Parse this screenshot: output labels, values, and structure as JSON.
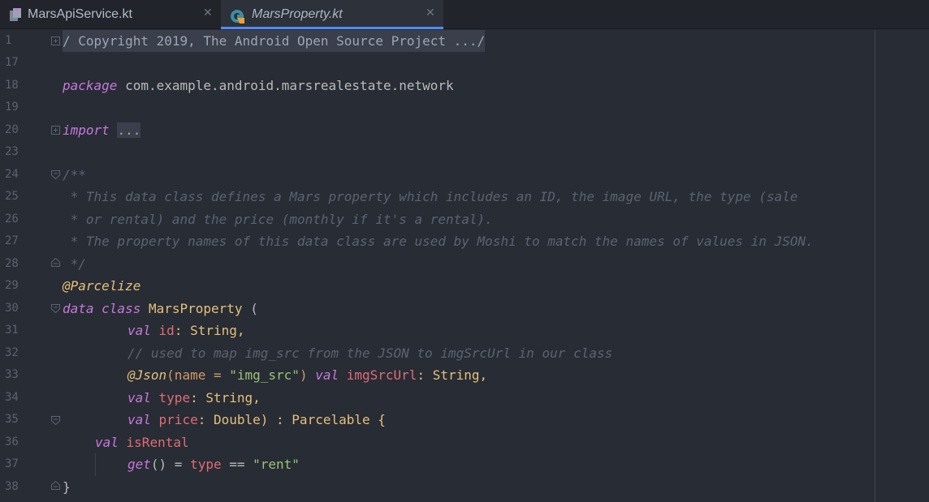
{
  "tabs": [
    {
      "label": "MarsApiService.kt",
      "close": "✕",
      "active": false
    },
    {
      "label": "MarsProperty.kt",
      "close": "✕",
      "active": true
    }
  ],
  "line_numbers": [
    "1",
    "17",
    "18",
    "19",
    "20",
    "23",
    "24",
    "25",
    "26",
    "27",
    "28",
    "29",
    "30",
    "31",
    "32",
    "33",
    "34",
    "35",
    "36",
    "37",
    "38"
  ],
  "code": {
    "l1": "/ Copyright 2019, The Android Open Source Project .../",
    "l18_kw": "package",
    "l18_rest": " com.example.android.marsrealestate.network",
    "l20_kw": "import",
    "l20_folded": "...",
    "l24": "/**",
    "l25": " * This data class defines a Mars property which includes an ID, the image URL, the type (sale",
    "l26": " * or rental) and the price (monthly if it's a rental).",
    "l27": " * The property names of this data class are used by Moshi to match the names of values in JSON.",
    "l28": " */",
    "l29": "@Parcelize",
    "l30_kw": "data class",
    "l30_name": " MarsProperty",
    "l30_rest": " (",
    "l31_kw": "val",
    "l31_prop": " id",
    "l31_rest": ": String,",
    "l32": "// used to map img_src from the JSON to imgSrcUrl in our class",
    "l33_ann": "@Json",
    "l33_a": "(name = ",
    "l33_str": "\"img_src\"",
    "l33_b": ") ",
    "l33_kw": "val",
    "l33_prop": " imgSrcUrl",
    "l33_rest": ": String,",
    "l34_kw": "val",
    "l34_prop": " type",
    "l34_rest": ": String,",
    "l35_kw": "val",
    "l35_prop": " price",
    "l35_rest": ": Double) : Parcelable {",
    "l36_kw": "val",
    "l36_prop": " isRental",
    "l37_fn": "get",
    "l37_a": "() = ",
    "l37_prop": "type",
    "l37_b": " == ",
    "l37_str": "\"rent\"",
    "l38": "}"
  },
  "colors": {
    "background": "#282c34",
    "keyword": "#c678dd",
    "comment": "#5c6370",
    "string": "#98c379",
    "property": "#e06c75",
    "type": "#e5c07b",
    "accent": "#528bff"
  },
  "icons": [
    "kotlin-file-icon",
    "kotlin-class-icon",
    "close-icon",
    "fold-icon"
  ]
}
